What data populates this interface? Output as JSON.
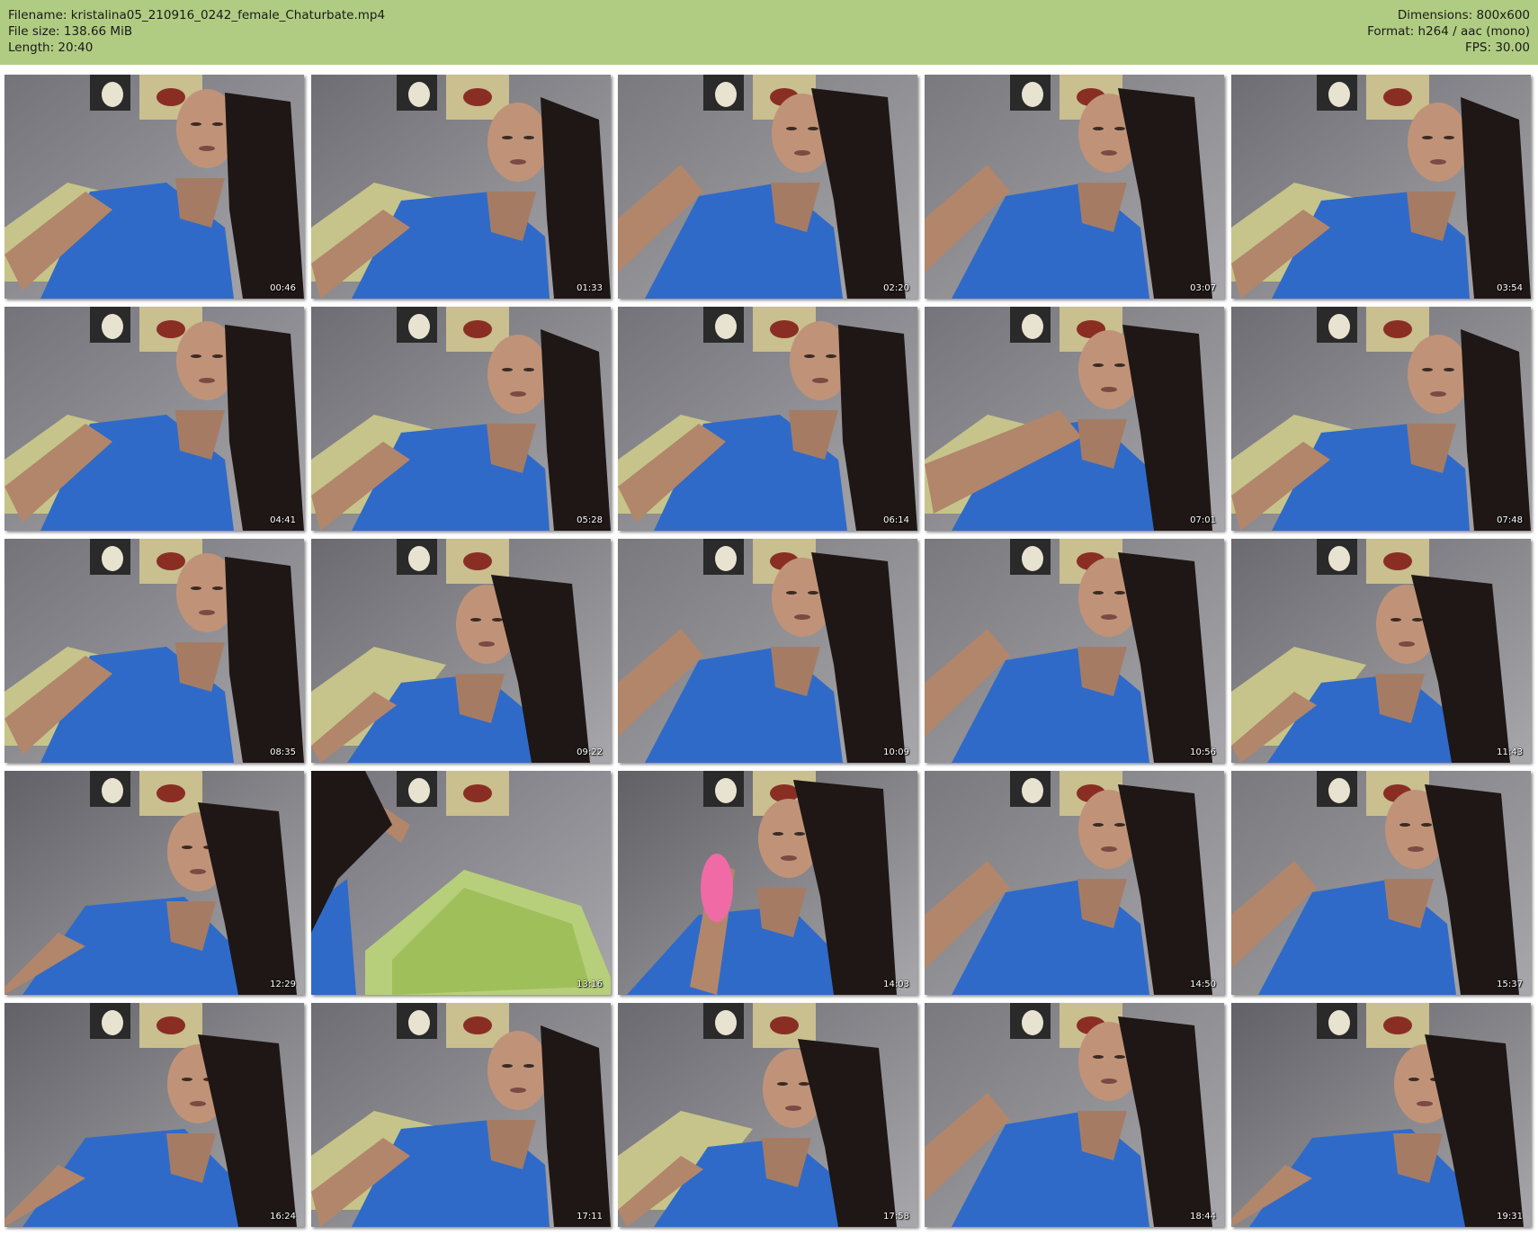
{
  "header": {
    "filename": "Filename: kristalina05_210916_0242_female_Chaturbate.mp4",
    "filesize": "File size: 138.66 MiB",
    "length": "Length: 20:40",
    "dimensions": "Dimensions: 800x600",
    "format": "Format: h264 / aac (mono)",
    "fps": "FPS: 30.00",
    "background_color": "#b0cc82"
  },
  "thumbnails": [
    {
      "time": "00:46",
      "variant": 0
    },
    {
      "time": "01:33",
      "variant": 1
    },
    {
      "time": "02:20",
      "variant": 2
    },
    {
      "time": "03:07",
      "variant": 2
    },
    {
      "time": "03:54",
      "variant": 1
    },
    {
      "time": "04:41",
      "variant": 0
    },
    {
      "time": "05:28",
      "variant": 1
    },
    {
      "time": "06:14",
      "variant": 0
    },
    {
      "time": "07:01",
      "variant": 3
    },
    {
      "time": "07:48",
      "variant": 1
    },
    {
      "time": "08:35",
      "variant": 0
    },
    {
      "time": "09:22",
      "variant": 4
    },
    {
      "time": "10:09",
      "variant": 2
    },
    {
      "time": "10:56",
      "variant": 2
    },
    {
      "time": "11:43",
      "variant": 4
    },
    {
      "time": "12:29",
      "variant": 5
    },
    {
      "time": "13:16",
      "variant": 6
    },
    {
      "time": "14:03",
      "variant": 7
    },
    {
      "time": "14:50",
      "variant": 2
    },
    {
      "time": "15:37",
      "variant": 2
    },
    {
      "time": "16:24",
      "variant": 5
    },
    {
      "time": "17:11",
      "variant": 1
    },
    {
      "time": "17:58",
      "variant": 4
    },
    {
      "time": "18:44",
      "variant": 2
    },
    {
      "time": "19:31",
      "variant": 5
    }
  ]
}
